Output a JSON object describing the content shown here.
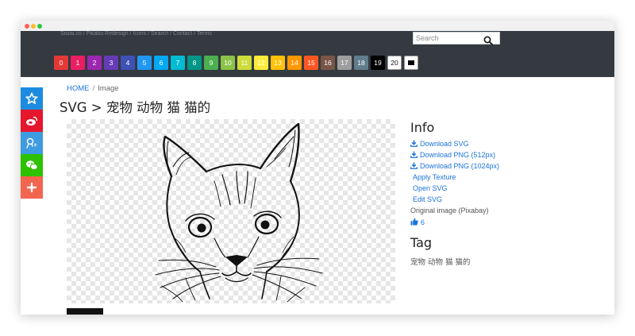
{
  "colors": {
    "navbar_bg": "#343a40",
    "link": "#1a73d9",
    "twitter": "#1d8ce0",
    "weibo": "#e6162d",
    "qq": "#3e9be0",
    "wechat": "#2dc100",
    "more": "#f2654f"
  },
  "navbar": {
    "top_text": "Sozai.co / Pikabu Redesign / Icons / Search / Contact / Terms",
    "search_placeholder": "Search",
    "search_icon": "search-icon"
  },
  "color_swatches": [
    {
      "label": "0",
      "color": "#e53935"
    },
    {
      "label": "1",
      "color": "#e91e63"
    },
    {
      "label": "2",
      "color": "#9c27b0"
    },
    {
      "label": "3",
      "color": "#673ab7"
    },
    {
      "label": "4",
      "color": "#3f51b5"
    },
    {
      "label": "5",
      "color": "#2196f3"
    },
    {
      "label": "6",
      "color": "#03a9f4"
    },
    {
      "label": "7",
      "color": "#00bcd4"
    },
    {
      "label": "8",
      "color": "#009688"
    },
    {
      "label": "9",
      "color": "#4caf50"
    },
    {
      "label": "10",
      "color": "#8bc34a"
    },
    {
      "label": "11",
      "color": "#cddc39"
    },
    {
      "label": "12",
      "color": "#ffeb3b"
    },
    {
      "label": "13",
      "color": "#ffc107"
    },
    {
      "label": "14",
      "color": "#ff9800"
    },
    {
      "label": "15",
      "color": "#ff5722"
    },
    {
      "label": "16",
      "color": "#795548"
    },
    {
      "label": "17",
      "color": "#9e9e9e"
    },
    {
      "label": "18",
      "color": "#607d8b"
    },
    {
      "label": "19",
      "color": "#000000"
    },
    {
      "label": "20",
      "color": "#ffffff"
    },
    {
      "label": "",
      "color": "#ffffff"
    }
  ],
  "social_buttons": [
    {
      "icon": "star-icon",
      "color": "#1d8ce0"
    },
    {
      "icon": "weibo-icon",
      "color": "#e6162d"
    },
    {
      "icon": "qq-icon",
      "color": "#3e9be0"
    },
    {
      "icon": "wechat-icon",
      "color": "#2dc100"
    },
    {
      "icon": "plus-icon",
      "color": "#f2654f"
    }
  ],
  "breadcrumb": {
    "home": "HOME",
    "separator": "/",
    "current": "Image"
  },
  "page_title": "SVG > 宠物 动物 猫 猫的",
  "info": {
    "title": "Info",
    "download_svg": "Download SVG",
    "download_png_512": "Download PNG (512px)",
    "download_png_1024": "Download PNG (1024px)",
    "apply_texture": "Apply Texture",
    "open_svg": "Open SVG",
    "edit_svg": "Edit SVG",
    "original_image": "Original image (Pixabay)",
    "likes": "6"
  },
  "tag": {
    "title": "Tag",
    "tags": "宠物 动物 猫 猫的"
  }
}
